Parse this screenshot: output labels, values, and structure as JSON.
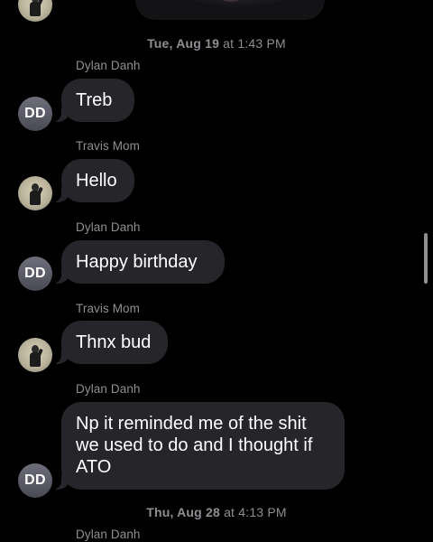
{
  "conversation": {
    "timestamps": [
      {
        "day": "Tue, Aug 19",
        "sep": " at ",
        "time": "1:43 PM"
      },
      {
        "day": "Thu, Aug 28",
        "sep": " at ",
        "time": "4:13 PM"
      }
    ],
    "messages": [
      {
        "sender": "Dylan Danh",
        "avatar": "DD",
        "text": "Treb"
      },
      {
        "sender": "Travis Mom",
        "avatar": "photo",
        "text": "Hello"
      },
      {
        "sender": "Dylan Danh",
        "avatar": "DD",
        "text": "Happy birthday"
      },
      {
        "sender": "Travis Mom",
        "avatar": "photo",
        "text": "Thnx bud"
      },
      {
        "sender": "Dylan Danh",
        "avatar": "DD",
        "text": "Np it reminded me of the shit we used to do and I thought if ATO"
      }
    ],
    "trailing_sender": "Dylan Danh",
    "avatar_initials": "DD"
  },
  "colors": {
    "background": "#000000",
    "bubble": "#26262a",
    "meta_text": "#8e8e93",
    "message_text": "#ffffff"
  },
  "icons": {
    "contact_photo": "person-photo-avatar",
    "initials_avatar": "initials-avatar"
  }
}
